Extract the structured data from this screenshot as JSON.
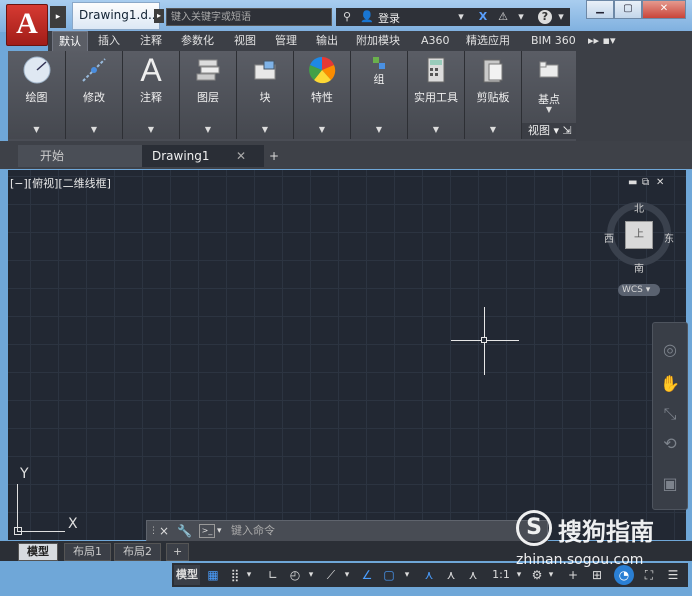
{
  "app": {
    "logo_letter": "A",
    "doc_title": "Drawing1.d...",
    "search_placeholder": "键入关键字或短语",
    "login": "登录"
  },
  "ribbon": {
    "tabs": [
      "默认",
      "插入",
      "注释",
      "参数化",
      "视图",
      "管理",
      "输出",
      "附加模块",
      "A360",
      "精选应用",
      "BIM 360"
    ],
    "active_tab": "默认",
    "panels": [
      {
        "label": "绘图",
        "icon": "draw-circle-icon"
      },
      {
        "label": "修改",
        "icon": "modify-icon"
      },
      {
        "label": "注释",
        "icon": "annotation-text-icon"
      },
      {
        "label": "图层",
        "icon": "layers-icon"
      },
      {
        "label": "块",
        "icon": "block-icon"
      },
      {
        "label": "特性",
        "icon": "properties-color-wheel-icon"
      },
      {
        "label": "组",
        "icon": "group-icon"
      },
      {
        "label": "实用工具",
        "icon": "calculator-icon"
      },
      {
        "label": "剪贴板",
        "icon": "clipboard-icon"
      },
      {
        "label": "基点",
        "icon": "basepoint-icon"
      }
    ],
    "view_label": "视图"
  },
  "file_tabs": {
    "start": "开始",
    "drawing": "Drawing1",
    "add": "+"
  },
  "viewport": {
    "label": "[−][俯视][二维线框]",
    "compass": {
      "north": "北",
      "south": "南",
      "east": "东",
      "west": "西",
      "face": "上"
    },
    "wcs": "WCS"
  },
  "ucs": {
    "x": "X",
    "y": "Y"
  },
  "command": {
    "placeholder": "键入命令",
    "close": "×"
  },
  "layout_tabs": [
    "模型",
    "布局1",
    "布局2"
  ],
  "layout_add": "+",
  "status": {
    "model": "模型",
    "scale": "1:1"
  },
  "watermark": {
    "brand": "搜狗指南",
    "url": "zhinan.sogou.com"
  },
  "colors": {
    "canvas": "#222833",
    "ribbon": "#4a4d55",
    "logo": "#c8312a",
    "accent": "#2a7fd4"
  }
}
